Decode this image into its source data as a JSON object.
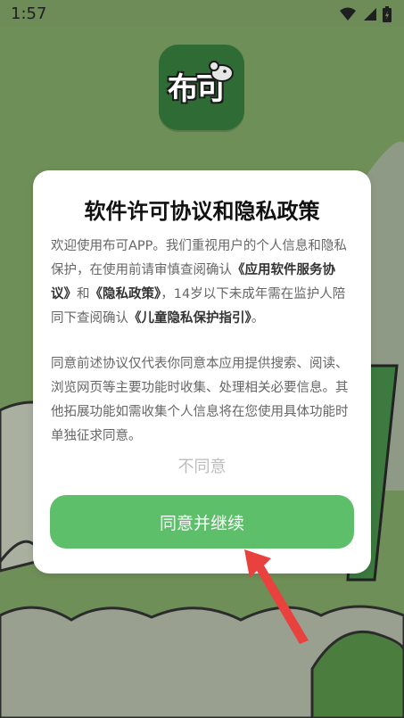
{
  "status_bar": {
    "time": "1:57"
  },
  "app": {
    "logo_text": "布可"
  },
  "dialog": {
    "title": "软件许可协议和隐私政策",
    "para1": {
      "t1": "欢迎使用布可APP。我们重视用户的个人信息和隐私保护，在使用前请审慎查阅确认",
      "link1": "《应用软件服务协议》",
      "t2": "和",
      "link2": "《隐私政策》",
      "t3": "，14岁以下未成年需在监护人陪同下查阅确认",
      "link3": "《儿童隐私保护指引》",
      "t4": "。"
    },
    "para2": "同意前述协议仅代表你同意本应用提供搜索、阅读、浏览网页等主要功能时收集、处理相关必要信息。其他拓展功能如需收集个人信息将在您使用具体功能时单独征求同意。",
    "disagree_label": "不同意",
    "agree_label": "同意并继续"
  },
  "colors": {
    "background": "#6f8f58",
    "logo_bg": "#2f6b34",
    "agree_button": "#5dbf6a",
    "arrow": "#e8413e"
  }
}
